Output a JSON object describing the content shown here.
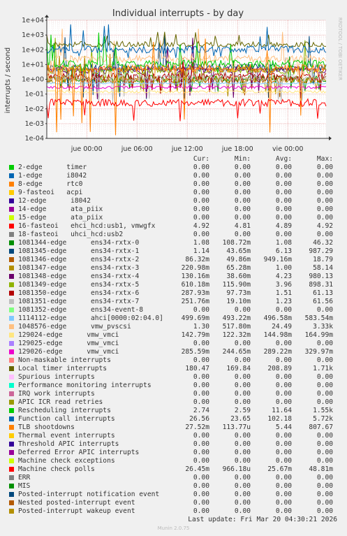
{
  "header": {
    "title": "Individual interrupts - by day",
    "side_text": "RRDTOOL / TOBI OETIKER"
  },
  "chart_data": {
    "type": "line",
    "title": "Individual interrupts - by day",
    "ylabel": "interrupts / second",
    "yscale": "log",
    "yticks": [
      "1e-04",
      "1e-03",
      "1e-02",
      "1e-01",
      "1e+00",
      "1e+01",
      "1e+02",
      "1e+03",
      "1e+04"
    ],
    "ylim": [
      0.0001,
      10000
    ],
    "xticks": [
      "jue 00:00",
      "jue 06:00",
      "jue 12:00",
      "jue 18:00",
      "vie 00:00"
    ],
    "grid": true,
    "series": [
      {
        "name": "2-edge      timer",
        "color": "#00cc00",
        "cur": "0.00",
        "min": "0.00",
        "avg": "0.00",
        "max": "0.00"
      },
      {
        "name": "1-edge      i8042",
        "color": "#0066b3",
        "cur": "0.00",
        "min": "0.00",
        "avg": "0.00",
        "max": "0.00"
      },
      {
        "name": "8-edge      rtc0",
        "color": "#ff8000",
        "cur": "0.00",
        "min": "0.00",
        "avg": "0.00",
        "max": "0.00"
      },
      {
        "name": "9-fasteoi   acpi",
        "color": "#ffcc00",
        "cur": "0.00",
        "min": "0.00",
        "avg": "0.00",
        "max": "0.00"
      },
      {
        "name": "12-edge      i8042",
        "color": "#330099",
        "cur": "0.00",
        "min": "0.00",
        "avg": "0.00",
        "max": "0.00"
      },
      {
        "name": "14-edge      ata_piix",
        "color": "#990099",
        "cur": "0.00",
        "min": "0.00",
        "avg": "0.00",
        "max": "0.00"
      },
      {
        "name": "15-edge      ata_piix",
        "color": "#ccff00",
        "cur": "0.00",
        "min": "0.00",
        "avg": "0.00",
        "max": "0.00"
      },
      {
        "name": "16-fasteoi   ehci_hcd:usb1, vmwgfx",
        "color": "#ff0000",
        "cur": "4.92",
        "min": "4.81",
        "avg": "4.89",
        "max": "4.92"
      },
      {
        "name": "18-fasteoi   uhci_hcd:usb2",
        "color": "#808080",
        "cur": "0.00",
        "min": "0.00",
        "avg": "0.00",
        "max": "0.00"
      },
      {
        "name": "1081344-edge      ens34-rxtx-0",
        "color": "#008f00",
        "cur": "1.08",
        "min": "108.72m",
        "avg": "1.08",
        "max": "46.32"
      },
      {
        "name": "1081345-edge      ens34-rxtx-1",
        "color": "#00487d",
        "cur": "1.14",
        "min": "43.65m",
        "avg": "6.13",
        "max": "987.29"
      },
      {
        "name": "1081346-edge      ens34-rxtx-2",
        "color": "#b35a00",
        "cur": "86.32m",
        "min": "49.86m",
        "avg": "949.16m",
        "max": "18.79"
      },
      {
        "name": "1081347-edge      ens34-rxtx-3",
        "color": "#b38f00",
        "cur": "220.98m",
        "min": "65.28m",
        "avg": "1.00",
        "max": "58.14"
      },
      {
        "name": "1081348-edge      ens34-rxtx-4",
        "color": "#6b006b",
        "cur": "130.16m",
        "min": "38.60m",
        "avg": "4.23",
        "max": "980.13"
      },
      {
        "name": "1081349-edge      ens34-rxtx-5",
        "color": "#8fb300",
        "cur": "610.18m",
        "min": "115.90m",
        "avg": "3.96",
        "max": "898.31"
      },
      {
        "name": "1081350-edge      ens34-rxtx-6",
        "color": "#b30000",
        "cur": "287.93m",
        "min": "97.73m",
        "avg": "1.51",
        "max": "61.13"
      },
      {
        "name": "1081351-edge      ens34-rxtx-7",
        "color": "#bebebe",
        "cur": "251.76m",
        "min": "19.10m",
        "avg": "1.23",
        "max": "61.56"
      },
      {
        "name": "1081352-edge      ens34-event-8",
        "color": "#80ff80",
        "cur": "0.00",
        "min": "0.00",
        "avg": "0.00",
        "max": "0.00"
      },
      {
        "name": "1114112-edge      ahci[0000:02:04.0]",
        "color": "#80c9ff",
        "cur": "499.69m",
        "min": "493.22m",
        "avg": "496.58m",
        "max": "583.54m"
      },
      {
        "name": "1048576-edge      vmw_pvscsi",
        "color": "#ffc080",
        "cur": "1.30",
        "min": "517.80m",
        "avg": "24.49",
        "max": "3.33k"
      },
      {
        "name": "129024-edge      vmw_vmci",
        "color": "#ffe680",
        "cur": "142.79m",
        "min": "122.32m",
        "avg": "144.98m",
        "max": "164.99m"
      },
      {
        "name": "129025-edge      vmw_vmci",
        "color": "#aa80ff",
        "cur": "0.00",
        "min": "0.00",
        "avg": "0.00",
        "max": "0.00"
      },
      {
        "name": "129026-edge      vmw_vmci",
        "color": "#ee00cc",
        "cur": "285.59m",
        "min": "244.65m",
        "avg": "289.22m",
        "max": "329.97m"
      },
      {
        "name": "Non-maskable interrupts",
        "color": "#ff8080",
        "cur": "0.00",
        "min": "0.00",
        "avg": "0.00",
        "max": "0.00"
      },
      {
        "name": "Local timer interrupts",
        "color": "#666600",
        "cur": "180.47",
        "min": "169.84",
        "avg": "208.89",
        "max": "1.71k"
      },
      {
        "name": "Spurious interrupts",
        "color": "#ffbfff",
        "cur": "0.00",
        "min": "0.00",
        "avg": "0.00",
        "max": "0.00"
      },
      {
        "name": "Performance monitoring interrupts",
        "color": "#00ffcc",
        "cur": "0.00",
        "min": "0.00",
        "avg": "0.00",
        "max": "0.00"
      },
      {
        "name": "IRQ work interrupts",
        "color": "#cc6699",
        "cur": "0.00",
        "min": "0.00",
        "avg": "0.00",
        "max": "0.00"
      },
      {
        "name": "APIC ICR read retries",
        "color": "#999900",
        "cur": "0.00",
        "min": "0.00",
        "avg": "0.00",
        "max": "0.00"
      },
      {
        "name": "Rescheduling interrupts",
        "color": "#00cc00",
        "cur": "2.74",
        "min": "2.59",
        "avg": "11.64",
        "max": "1.55k"
      },
      {
        "name": "Function call interrupts",
        "color": "#0066b3",
        "cur": "26.56",
        "min": "23.65",
        "avg": "102.18",
        "max": "5.72k"
      },
      {
        "name": "TLB shootdowns",
        "color": "#ff8000",
        "cur": "27.52m",
        "min": "113.77u",
        "avg": "5.44",
        "max": "807.67"
      },
      {
        "name": "Thermal event interrupts",
        "color": "#ffcc00",
        "cur": "0.00",
        "min": "0.00",
        "avg": "0.00",
        "max": "0.00"
      },
      {
        "name": "Threshold APIC interrupts",
        "color": "#330099",
        "cur": "0.00",
        "min": "0.00",
        "avg": "0.00",
        "max": "0.00"
      },
      {
        "name": "Deferred Error APIC interrupts",
        "color": "#990099",
        "cur": "0.00",
        "min": "0.00",
        "avg": "0.00",
        "max": "0.00"
      },
      {
        "name": "Machine check exceptions",
        "color": "#ccff00",
        "cur": "0.00",
        "min": "0.00",
        "avg": "0.00",
        "max": "0.00"
      },
      {
        "name": "Machine check polls",
        "color": "#ff0000",
        "cur": "26.45m",
        "min": "966.18u",
        "avg": "25.67m",
        "max": "48.81m"
      },
      {
        "name": "ERR",
        "color": "#808080",
        "cur": "0.00",
        "min": "0.00",
        "avg": "0.00",
        "max": "0.00"
      },
      {
        "name": "MIS",
        "color": "#008f00",
        "cur": "0.00",
        "min": "0.00",
        "avg": "0.00",
        "max": "0.00"
      },
      {
        "name": "Posted-interrupt notification event",
        "color": "#00487d",
        "cur": "0.00",
        "min": "0.00",
        "avg": "0.00",
        "max": "0.00"
      },
      {
        "name": "Nested posted-interrupt event",
        "color": "#b35a00",
        "cur": "0.00",
        "min": "0.00",
        "avg": "0.00",
        "max": "0.00"
      },
      {
        "name": "Posted-interrupt wakeup event",
        "color": "#b38f00",
        "cur": "0.00",
        "min": "0.00",
        "avg": "0.00",
        "max": "0.00"
      }
    ]
  },
  "legend_header": {
    "cur": "Cur:",
    "min": "Min:",
    "avg": "Avg:",
    "max": "Max:"
  },
  "footer": {
    "last_update": "Last update: Fri Mar 20 04:30:21 2026",
    "version": "Munin 2.0.75"
  }
}
